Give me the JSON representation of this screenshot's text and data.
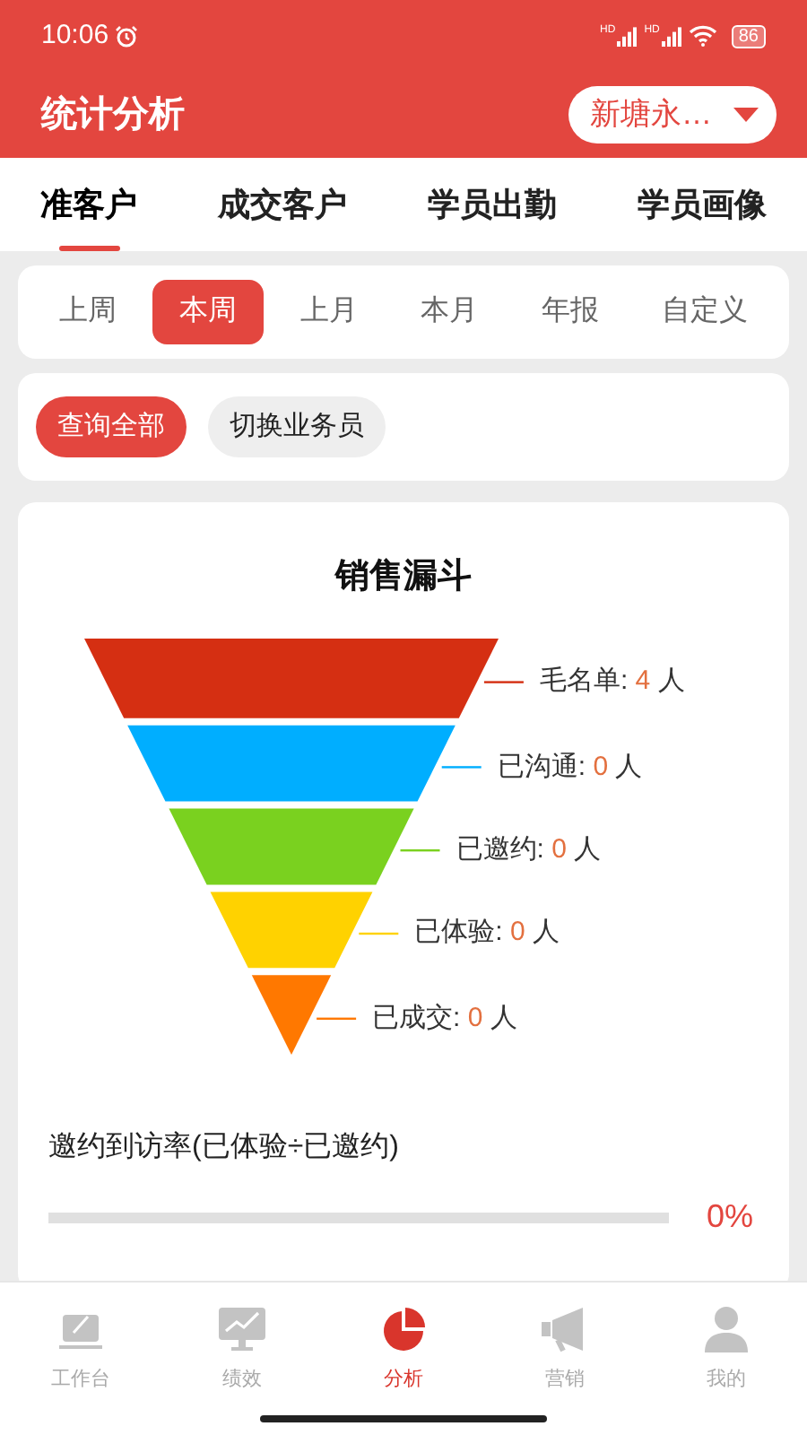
{
  "status_bar": {
    "time": "10:06",
    "signals": [
      "HD",
      "HD"
    ],
    "battery": "86"
  },
  "header": {
    "title": "统计分析",
    "store_select": "新塘永…"
  },
  "tabs": [
    {
      "label": "准客户",
      "selected": true
    },
    {
      "label": "成交客户",
      "selected": false
    },
    {
      "label": "学员出勤",
      "selected": false
    },
    {
      "label": "学员画像",
      "selected": false
    }
  ],
  "periods": [
    {
      "label": "上周",
      "selected": false
    },
    {
      "label": "本周",
      "selected": true
    },
    {
      "label": "上月",
      "selected": false
    },
    {
      "label": "本月",
      "selected": false
    },
    {
      "label": "年报",
      "selected": false
    },
    {
      "label": "自定义",
      "selected": false
    }
  ],
  "filters": [
    {
      "label": "查询全部",
      "selected": true
    },
    {
      "label": "切换业务员",
      "selected": false
    }
  ],
  "funnel": {
    "title": "销售漏斗",
    "stages": [
      {
        "name": "毛名单:",
        "count": "4",
        "unit": "人",
        "color": "#d52f12"
      },
      {
        "name": "已沟通:",
        "count": "0",
        "unit": "人",
        "color": "#00aeff"
      },
      {
        "name": "已邀约:",
        "count": "0",
        "unit": "人",
        "color": "#7ad11f"
      },
      {
        "name": "已体验:",
        "count": "0",
        "unit": "人",
        "color": "#ffd200"
      },
      {
        "name": "已成交:",
        "count": "0",
        "unit": "人",
        "color": "#ff7800"
      }
    ]
  },
  "rate": {
    "title": "邀约到访率(已体验÷已邀约)",
    "level": 0,
    "reading": "0%"
  },
  "nav": [
    {
      "label": "工作台",
      "selected": false,
      "kind": "desk"
    },
    {
      "label": "绩效",
      "selected": false,
      "kind": "chart"
    },
    {
      "label": "分析",
      "selected": true,
      "kind": "pie"
    },
    {
      "label": "营销",
      "selected": false,
      "kind": "horn"
    },
    {
      "label": "我的",
      "selected": false,
      "kind": "person"
    }
  ]
}
